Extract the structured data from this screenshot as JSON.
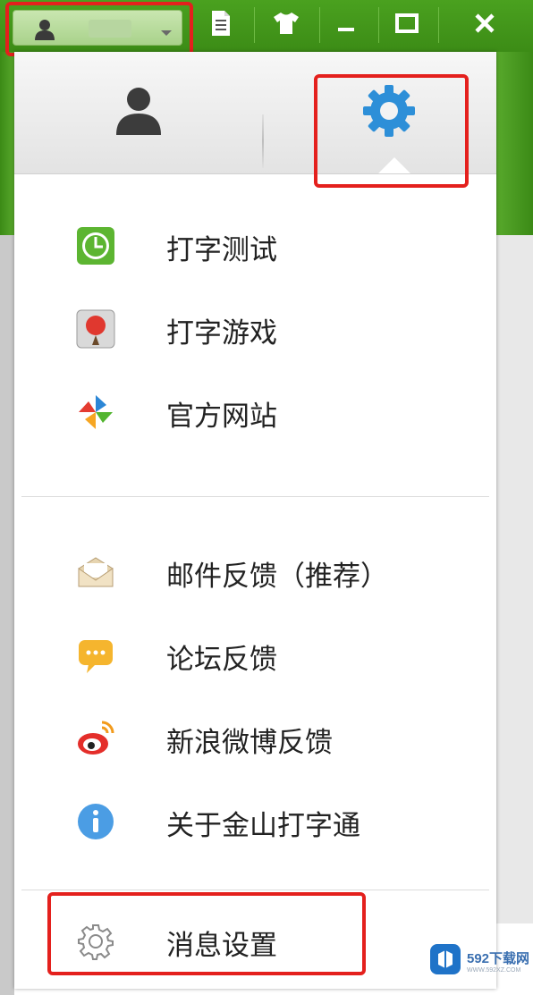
{
  "titlebar": {
    "account": {
      "icons": [
        "user-icon",
        "chevron-down-icon"
      ]
    },
    "buttons": [
      "document-icon",
      "tshirt-skin-icon",
      "minimize-icon",
      "maximize-icon",
      "close-icon"
    ]
  },
  "menu": {
    "tabs": [
      {
        "icon": "user-icon",
        "active": false
      },
      {
        "icon": "gear-icon",
        "active": true
      }
    ],
    "group1": [
      {
        "label": "打字测试",
        "icon": "clock-icon"
      },
      {
        "label": "打字游戏",
        "icon": "balloon-game-icon"
      },
      {
        "label": "官方网站",
        "icon": "pinwheel-icon"
      }
    ],
    "group2": [
      {
        "label": "邮件反馈（推荐）",
        "icon": "mail-icon"
      },
      {
        "label": "论坛反馈",
        "icon": "chat-bubble-icon"
      },
      {
        "label": "新浪微博反馈",
        "icon": "weibo-icon"
      },
      {
        "label": "关于金山打字通",
        "icon": "info-icon"
      }
    ],
    "group3": [
      {
        "label": "消息设置",
        "icon": "settings-gear-icon"
      }
    ]
  },
  "watermark": {
    "text": "592下载网",
    "sub": "WWW.592XZ.COM"
  },
  "colors": {
    "title_bar": "#3f9219",
    "highlight_box": "#e4201d",
    "gear_blue": "#2d8fd8"
  }
}
